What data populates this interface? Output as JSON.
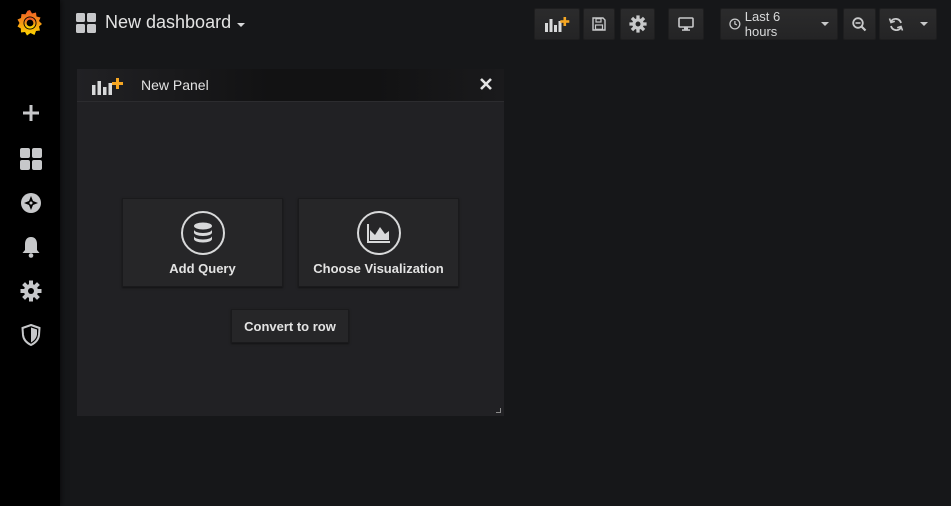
{
  "sidemenu": {
    "items": [
      {
        "name": "create",
        "icon": "plus-icon"
      },
      {
        "name": "dashboards",
        "icon": "dashboards-grid-icon"
      },
      {
        "name": "explore",
        "icon": "compass-icon"
      },
      {
        "name": "alerting",
        "icon": "bell-icon"
      },
      {
        "name": "configuration",
        "icon": "gear-icon"
      },
      {
        "name": "server-admin",
        "icon": "shield-icon"
      }
    ]
  },
  "navbar": {
    "title": "New dashboard",
    "time_range": "Last 6 hours"
  },
  "panel": {
    "title": "New Panel",
    "add_query_label": "Add Query",
    "choose_viz_label": "Choose Visualization",
    "convert_label": "Convert to row"
  },
  "colors": {
    "accent_orange": "#f5a623",
    "logo_orange": "#f05a28",
    "background": "#161719",
    "panel_bg": "#212124"
  }
}
